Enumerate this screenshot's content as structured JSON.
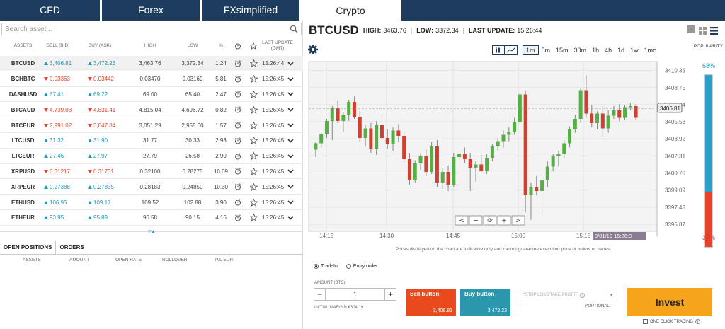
{
  "tabs": [
    {
      "label": "CFD",
      "active": false
    },
    {
      "label": "Forex",
      "active": false
    },
    {
      "label": "FXsimplified",
      "active": false
    },
    {
      "label": "Crypto",
      "active": true
    }
  ],
  "search": {
    "placeholder": "Search asset..."
  },
  "table": {
    "headers": {
      "assets": "ASSETS",
      "sell": "SELL (BID)",
      "buy": "BUY (ASK)",
      "high": "HIGH",
      "low": "LOW",
      "pct": "%",
      "last": "LAST UPDATE (GMT)"
    },
    "rows": [
      {
        "asset": "BTCUSD",
        "sell": "3,406.81",
        "buy": "3,472.23",
        "high": "3,463.76",
        "low": "3,372.34",
        "pct": "1.24",
        "time": "15:26:44",
        "dir": "up"
      },
      {
        "asset": "BCHBTC",
        "sell": "0.03363",
        "buy": "0.03442",
        "high": "0.03470",
        "low": "0.03169",
        "pct": "5.81",
        "time": "15:26:45",
        "dir": "dn"
      },
      {
        "asset": "DASHUSD",
        "sell": "67.41",
        "buy": "69.22",
        "high": "69.00",
        "low": "65.40",
        "pct": "2.47",
        "time": "15:26:45",
        "dir": "up"
      },
      {
        "asset": "BTCAUD",
        "sell": "4,739.03",
        "buy": "4,831.41",
        "high": "4,815.04",
        "low": "4,696.72",
        "pct": "0.82",
        "time": "15:26:45",
        "dir": "dn"
      },
      {
        "asset": "BTCEUR",
        "sell": "2,991.02",
        "buy": "3,047.84",
        "high": "3,051.29",
        "low": "2,955.00",
        "pct": "1.57",
        "time": "15:26:45",
        "dir": "dn"
      },
      {
        "asset": "LTCUSD",
        "sell": "31.32",
        "buy": "31.90",
        "high": "31.77",
        "low": "30.33",
        "pct": "2.93",
        "time": "15:26:45",
        "dir": "up"
      },
      {
        "asset": "LTCEUR",
        "sell": "27.46",
        "buy": "27.97",
        "high": "27.79",
        "low": "26.58",
        "pct": "2.90",
        "time": "15:26:45",
        "dir": "up"
      },
      {
        "asset": "XRPUSD",
        "sell": "0.31217",
        "buy": "0.31731",
        "high": "0.32100",
        "low": "0.28275",
        "pct": "10.09",
        "time": "15:26:45",
        "dir": "dn"
      },
      {
        "asset": "XRPEUR",
        "sell": "0.27388",
        "buy": "0.27835",
        "high": "0.28183",
        "low": "0.24850",
        "pct": "10.30",
        "time": "15:26:45",
        "dir": "up"
      },
      {
        "asset": "ETHUSD",
        "sell": "106.95",
        "buy": "109.17",
        "high": "109.52",
        "low": "102.88",
        "pct": "3.90",
        "time": "15:26:45",
        "dir": "up"
      },
      {
        "asset": "ETHEUR",
        "sell": "93.95",
        "buy": "95.89",
        "high": "96.58",
        "low": "90.15",
        "pct": "4.16",
        "time": "15:26:45",
        "dir": "up"
      }
    ]
  },
  "positions": {
    "tabs": [
      "OPEN POSITIONS",
      "ORDERS"
    ],
    "headers": [
      "ASSETS",
      "AMOUNT",
      "OPEN RATE",
      "ROLLOVER",
      "P/L EUR"
    ]
  },
  "header": {
    "symbol": "BTCUSD",
    "high_label": "HIGH:",
    "high": "3463.76",
    "low_label": "LOW:",
    "low": "3372.34",
    "last_label": "LAST UPDATE:",
    "last": "15:26:44"
  },
  "ranges": [
    {
      "label": "1m",
      "active": true
    },
    {
      "label": "5m"
    },
    {
      "label": "15m"
    },
    {
      "label": "30m"
    },
    {
      "label": "1h"
    },
    {
      "label": "4h"
    },
    {
      "label": "1d"
    },
    {
      "label": "1w"
    },
    {
      "label": "1mo"
    }
  ],
  "popularity": {
    "label": "POPULARITY",
    "buy_pct": "68%",
    "sell_pct": "32%",
    "buy_fraction": 0.68
  },
  "chart_data": {
    "type": "candlestick",
    "yticks": [
      "3410.36",
      "3408.75",
      "3407.14",
      "3405.53",
      "3403.92",
      "3402.31",
      "3400.70",
      "3399.09",
      "3397.48",
      "3395.87"
    ],
    "ylim": [
      3395.2,
      3411.2
    ],
    "xticks": [
      "14:15",
      "14:30",
      "14:45",
      "15:00",
      "15:15"
    ],
    "current_price_label": "3406.81",
    "current_price": 3406.81,
    "time_label": "0/01/19 15:26:0",
    "nav_buttons": [
      "<",
      "−",
      "⟳",
      "+",
      ">"
    ],
    "candles": [
      [
        3402.9,
        3403.6,
        3402.2,
        3403.5
      ],
      [
        3403.5,
        3404.6,
        3403.1,
        3404.4
      ],
      [
        3404.4,
        3405.8,
        3404.0,
        3405.6
      ],
      [
        3405.6,
        3407.0,
        3403.8,
        3406.8
      ],
      [
        3406.8,
        3407.5,
        3405.4,
        3405.6
      ],
      [
        3405.6,
        3406.4,
        3404.6,
        3406.2
      ],
      [
        3406.2,
        3407.6,
        3405.6,
        3407.4
      ],
      [
        3407.4,
        3407.9,
        3405.8,
        3406.0
      ],
      [
        3406.0,
        3406.5,
        3403.6,
        3404.0
      ],
      [
        3404.0,
        3405.2,
        3403.2,
        3404.9
      ],
      [
        3404.9,
        3405.4,
        3402.6,
        3403.0
      ],
      [
        3403.0,
        3405.6,
        3402.4,
        3405.2
      ],
      [
        3405.2,
        3406.2,
        3403.8,
        3404.0
      ],
      [
        3404.0,
        3404.8,
        3403.0,
        3403.4
      ],
      [
        3403.4,
        3405.0,
        3402.8,
        3404.7
      ],
      [
        3404.7,
        3405.3,
        3403.6,
        3404.2
      ],
      [
        3404.2,
        3404.7,
        3401.6,
        3402.0
      ],
      [
        3402.0,
        3402.6,
        3399.6,
        3400.0
      ],
      [
        3400.0,
        3401.9,
        3399.8,
        3401.6
      ],
      [
        3401.6,
        3402.6,
        3401.0,
        3402.3
      ],
      [
        3402.3,
        3402.9,
        3400.4,
        3400.8
      ],
      [
        3400.8,
        3403.6,
        3400.6,
        3403.2
      ],
      [
        3403.2,
        3403.8,
        3399.4,
        3399.8
      ],
      [
        3399.8,
        3401.2,
        3399.2,
        3400.8
      ],
      [
        3400.8,
        3401.4,
        3399.0,
        3399.6
      ],
      [
        3399.6,
        3402.6,
        3399.4,
        3402.2
      ],
      [
        3402.2,
        3402.8,
        3401.6,
        3402.5
      ],
      [
        3402.5,
        3403.1,
        3401.6,
        3402.0
      ],
      [
        3402.0,
        3402.6,
        3399.0,
        3401.2
      ],
      [
        3401.2,
        3401.8,
        3399.9,
        3401.5
      ],
      [
        3401.5,
        3402.4,
        3400.8,
        3400.9
      ],
      [
        3400.9,
        3402.5,
        3400.6,
        3402.1
      ],
      [
        3402.1,
        3403.4,
        3401.8,
        3403.2
      ],
      [
        3403.2,
        3404.0,
        3402.8,
        3403.7
      ],
      [
        3403.7,
        3404.7,
        3403.1,
        3404.3
      ],
      [
        3404.3,
        3405.0,
        3403.7,
        3404.6
      ],
      [
        3404.6,
        3405.9,
        3404.3,
        3405.5
      ],
      [
        3405.5,
        3408.3,
        3405.3,
        3408.1
      ],
      [
        3408.1,
        3408.5,
        3397.0,
        3398.6
      ],
      [
        3398.6,
        3399.8,
        3396.3,
        3399.4
      ],
      [
        3399.4,
        3400.4,
        3398.6,
        3399.0
      ],
      [
        3399.0,
        3400.2,
        3396.8,
        3400.0
      ],
      [
        3400.0,
        3401.8,
        3399.4,
        3401.3
      ],
      [
        3401.3,
        3402.5,
        3400.9,
        3402.3
      ],
      [
        3402.3,
        3402.8,
        3401.3,
        3402.5
      ],
      [
        3402.5,
        3403.8,
        3402.1,
        3403.5
      ],
      [
        3403.5,
        3405.1,
        3403.1,
        3404.8
      ],
      [
        3404.8,
        3406.2,
        3404.5,
        3405.8
      ],
      [
        3405.8,
        3408.7,
        3405.4,
        3408.5
      ],
      [
        3408.5,
        3409.9,
        3405.9,
        3406.3
      ],
      [
        3406.3,
        3407.1,
        3405.0,
        3405.4
      ],
      [
        3405.4,
        3406.5,
        3404.8,
        3406.3
      ],
      [
        3406.3,
        3407.0,
        3404.1,
        3404.9
      ],
      [
        3404.9,
        3406.6,
        3404.5,
        3406.1
      ],
      [
        3406.1,
        3407.0,
        3405.8,
        3406.6
      ],
      [
        3406.6,
        3407.2,
        3405.6,
        3405.9
      ],
      [
        3405.9,
        3407.1,
        3405.7,
        3406.9
      ],
      [
        3406.9,
        3407.3,
        3406.6,
        3407.0
      ],
      [
        3407.0,
        3407.2,
        3405.7,
        3405.9
      ]
    ]
  },
  "chart_disclaimer": "Prices displayed on the chart are indicative only and cannot guarantee execution price of orders or trades.",
  "order": {
    "mode_tradein": "TradeIn",
    "mode_entry": "Entry order",
    "amount_label": "AMOUNT (BTC)",
    "amount": "1",
    "margin": "INITIAL MARGIN €304.19",
    "sell_label": "Sell button",
    "sell_price": "3,406.81",
    "buy_label": "Buy button",
    "buy_price": "3,472.23",
    "stop_placeholder": "*STOP LOSS/TAKE PROFIT",
    "optional": "(*OPTIONAL)",
    "invest": "Invest",
    "oneclick": "ONE CLICK TRADING"
  },
  "colors": {
    "up": "#55b043",
    "down": "#d23e30",
    "accent": "#1d3c5e",
    "sell": "#e8491d",
    "buy": "#2a97ad",
    "invest": "#f5a41c"
  }
}
